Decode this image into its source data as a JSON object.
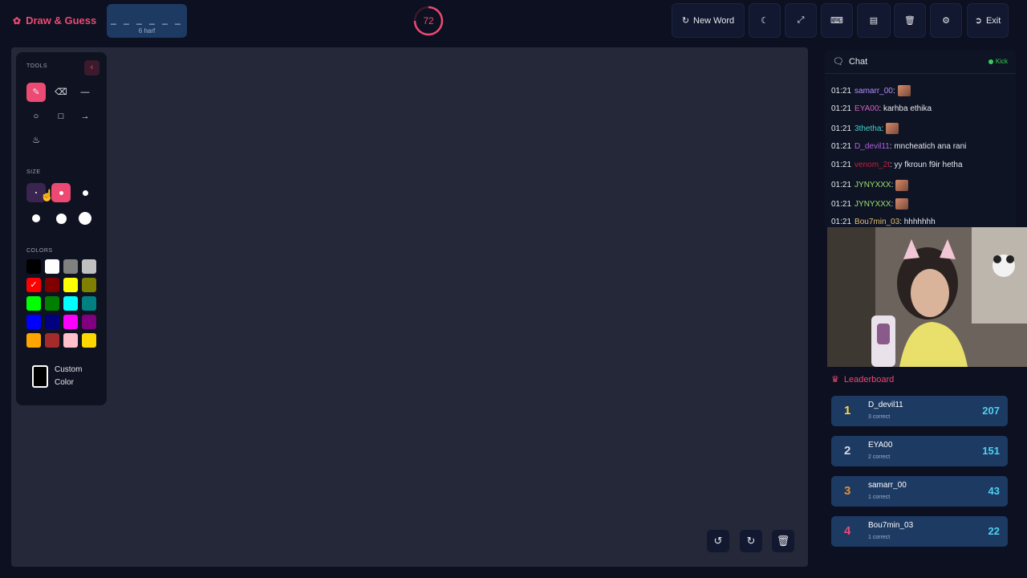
{
  "header": {
    "brand": "Draw & Guess",
    "word_mask": "_ _ _ _ _ _",
    "word_hint": "6 harf",
    "timer": "72",
    "new_word_label": "New Word",
    "exit_label": "Exit"
  },
  "tools": {
    "title": "TOOLS",
    "size_label": "SIZE",
    "colors_label": "COLORS",
    "custom_color_label": "Custom Color",
    "palette": [
      "#000000",
      "#ffffff",
      "#808080",
      "#c0c0c0",
      "#ff0000",
      "#800000",
      "#ffff00",
      "#808000",
      "#00ff00",
      "#008000",
      "#00ffff",
      "#008080",
      "#0000ff",
      "#000080",
      "#ff00ff",
      "#800080",
      "#ffa500",
      "#a52a2a",
      "#ffc0cb",
      "#ffd700"
    ],
    "selected_color": "#ff0000"
  },
  "chat": {
    "title": "Chat",
    "platform": "Kick",
    "messages": [
      {
        "time": "01:21",
        "user": "samarr_00",
        "text": ":",
        "user_color": "#b48cff",
        "emote": true
      },
      {
        "time": "01:21",
        "user": "EYA00",
        "text": ": karhba ethika",
        "user_color": "#d060c0",
        "emote": false
      },
      {
        "time": "01:21",
        "user": "3thetha",
        "text": ":",
        "user_color": "#40d0c8",
        "emote": true
      },
      {
        "time": "01:21",
        "user": "D_devil11",
        "text": ": mncheatich ana rani",
        "user_color": "#b060e0",
        "emote": false
      },
      {
        "time": "01:21",
        "user": "venom_2t",
        "text": ": yy fkroun f9ir hetha",
        "user_color": "#c0203a",
        "emote": false
      },
      {
        "time": "01:21",
        "user": "JYNYXXX",
        "text": ":",
        "user_color": "#9fe070",
        "emote": true
      },
      {
        "time": "01:21",
        "user": "JYNYXXX",
        "text": ":",
        "user_color": "#9fe070",
        "emote": true
      },
      {
        "time": "01:21",
        "user": "Bou7min_03",
        "text": ": hhhhhhh",
        "user_color": "#e0c070",
        "emote": false
      }
    ]
  },
  "leaderboard": {
    "title": "Leaderboard",
    "entries": [
      {
        "rank": "1",
        "name": "D_devil11",
        "correct": "3 correct",
        "score": "207",
        "rank_color": "#ffd84a"
      },
      {
        "rank": "2",
        "name": "EYA00",
        "correct": "2 correct",
        "score": "151",
        "rank_color": "#d0d8e8"
      },
      {
        "rank": "3",
        "name": "samarr_00",
        "correct": "1 correct",
        "score": "43",
        "rank_color": "#e0903a"
      },
      {
        "rank": "4",
        "name": "Bou7min_03",
        "correct": "1 correct",
        "score": "22",
        "rank_color": "#ec4a72"
      }
    ]
  }
}
